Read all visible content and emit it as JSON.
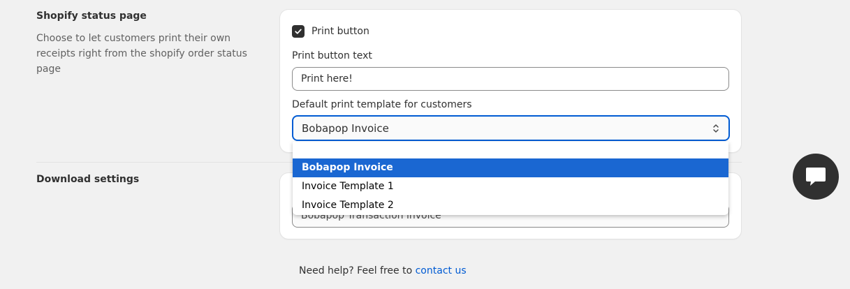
{
  "status_section": {
    "title": "Shopify status page",
    "description": "Choose to let customers print their own receipts right from the shopify order status page"
  },
  "print_card": {
    "checkbox_label": "Print button",
    "checkbox_checked": true,
    "text_label": "Print button text",
    "text_value": "Print here!",
    "template_label": "Default print template for customers",
    "template_selected": "Bobapop Invoice",
    "options": [
      "",
      "Bobapop Invoice",
      "Invoice Template 1",
      "Invoice Template 2"
    ]
  },
  "download_section": {
    "title": "Download settings",
    "select_value": "Bobapop Transaction invoice"
  },
  "footer": {
    "help_text": "Need help? Feel free to",
    "link_text": "contact us"
  },
  "colors": {
    "accent": "#005bd3",
    "selected_option": "#1a67d2",
    "chat_button": "#303030"
  },
  "icons": {
    "checkbox": "checkmark-icon",
    "select": "chevron-up-down-icon",
    "chat": "chat-bubble-icon"
  }
}
